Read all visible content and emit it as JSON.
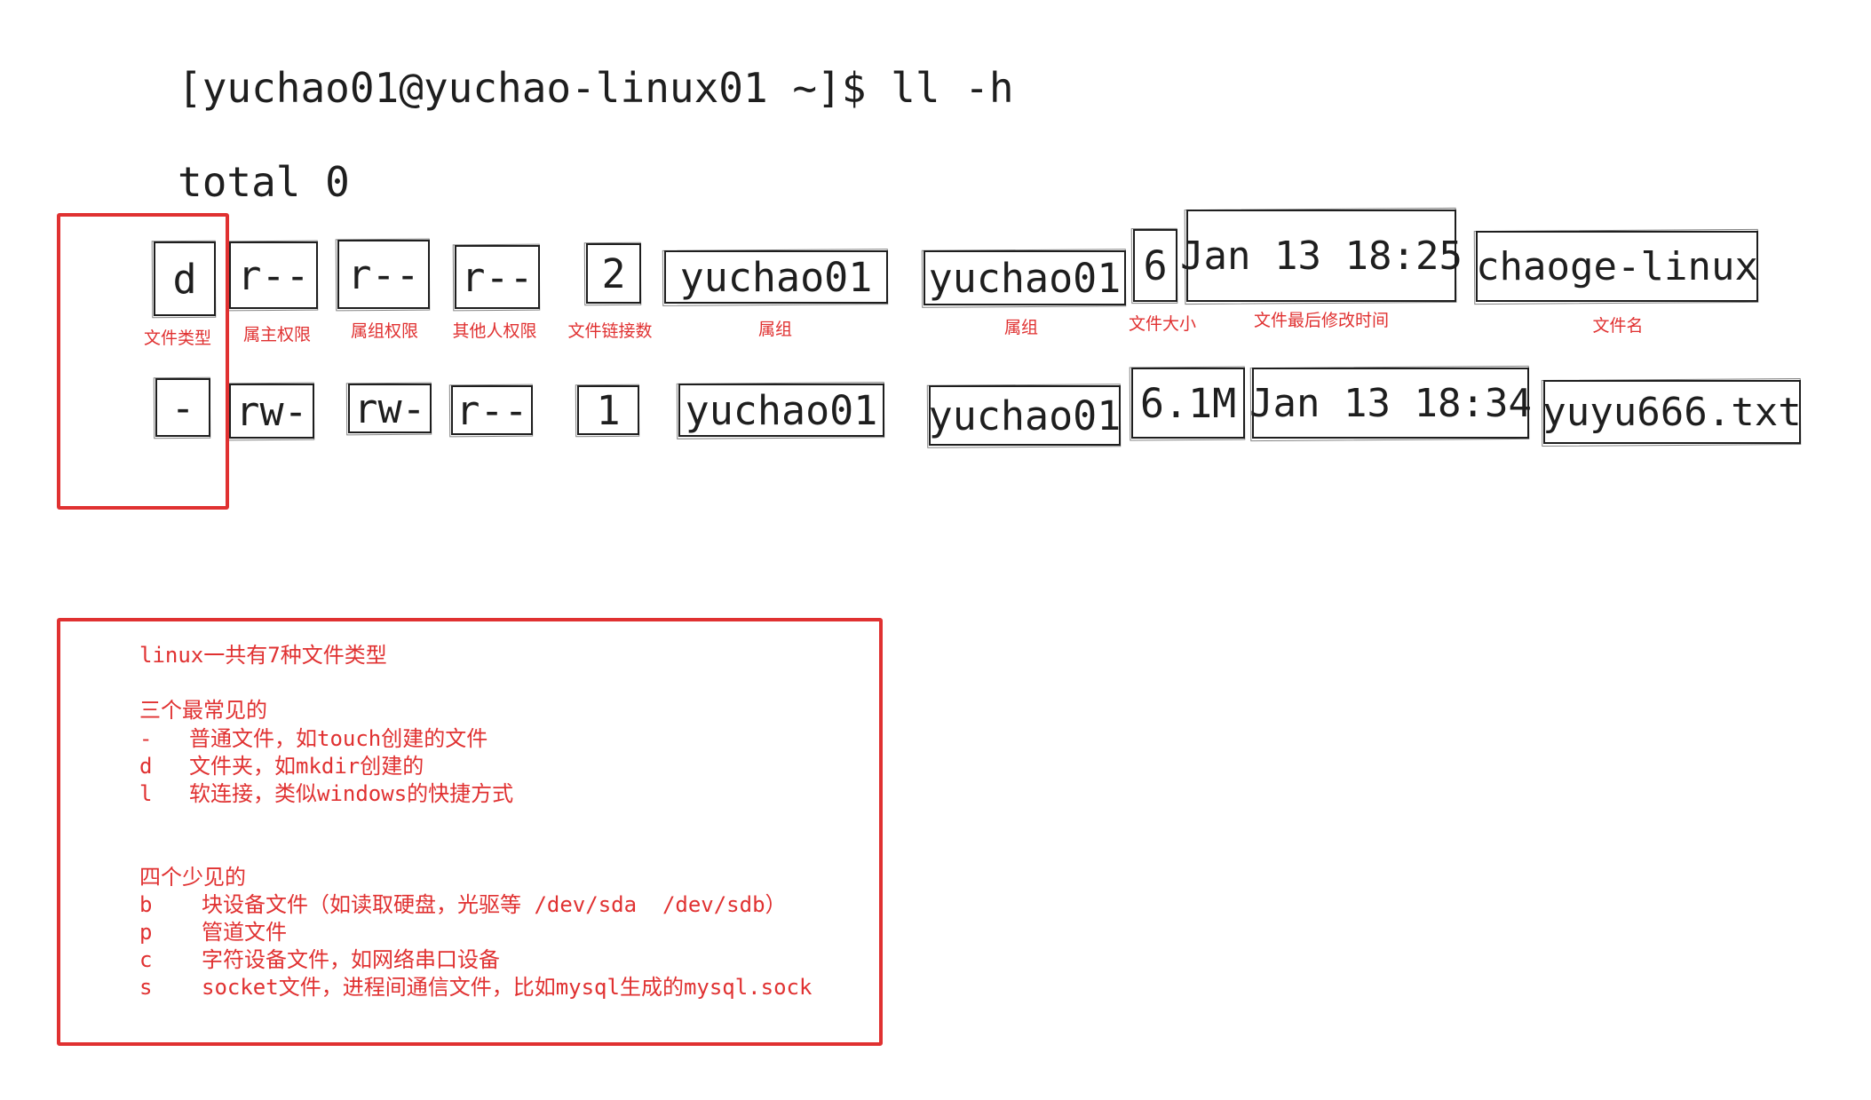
{
  "prompt": "[yuchao01@yuchao-linux01 ~]$ ll -h",
  "total": "total 0",
  "rows": [
    [
      "d",
      "r--",
      "r--",
      "r--",
      "2",
      "yuchao01",
      "yuchao01",
      "6",
      "Jan 13 18:25",
      "chaoge-linux"
    ],
    [
      "-",
      "rw-",
      "rw-",
      "r--",
      "1",
      "yuchao01",
      "yuchao01",
      "6.1M",
      "Jan 13 18:34",
      "yuyu666.txt"
    ]
  ],
  "labels": [
    "文件类型",
    "属主权限",
    "属组权限",
    "其他人权限",
    "文件链接数",
    "属组",
    "属组",
    "文件大小",
    "文件最后修改时间",
    "文件名"
  ],
  "note": {
    "title": "linux一共有7种文件类型",
    "common_title": "三个最常见的",
    "common": [
      {
        "key": "-",
        "desc": "普通文件，如touch创建的文件"
      },
      {
        "key": "d",
        "desc": "文件夹，如mkdir创建的"
      },
      {
        "key": "l",
        "desc": "软连接，类似windows的快捷方式"
      }
    ],
    "rare_title": "四个少见的",
    "rare": [
      {
        "key": "b",
        "desc": "块设备文件（如读取硬盘，光驱等 /dev/sda  /dev/sdb）"
      },
      {
        "key": "p",
        "desc": "管道文件"
      },
      {
        "key": "c",
        "desc": "字符设备文件，如网络串口设备"
      },
      {
        "key": "s",
        "desc": "socket文件，进程间通信文件，比如mysql生成的mysql.sock"
      }
    ]
  },
  "colors": {
    "accent": "#e03131",
    "ink": "#1e1e1e"
  }
}
